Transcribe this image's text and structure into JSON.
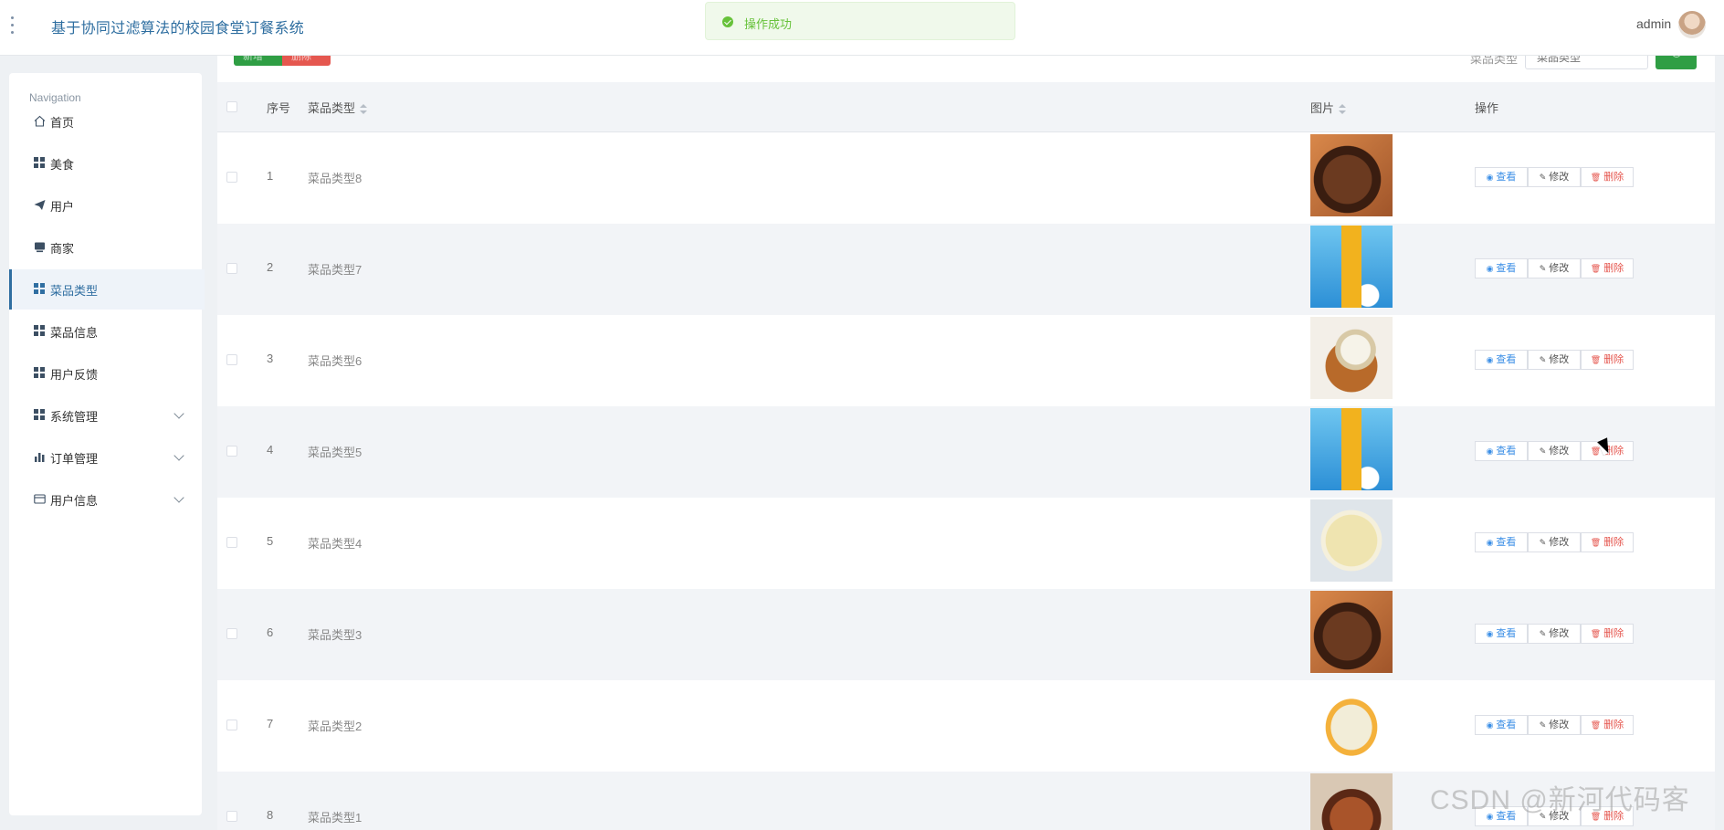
{
  "header": {
    "app_title": "基于协同过滤算法的校园食堂订餐系统",
    "toast": "操作成功",
    "user_name": "admin"
  },
  "sidebar": {
    "heading": "Navigation",
    "items": [
      {
        "label": "首页",
        "icon": "home-icon"
      },
      {
        "label": "美食",
        "icon": "grid-icon"
      },
      {
        "label": "用户",
        "icon": "send-icon"
      },
      {
        "label": "商家",
        "icon": "store-icon"
      },
      {
        "label": "菜品类型",
        "icon": "grid-icon",
        "active": true
      },
      {
        "label": "菜品信息",
        "icon": "grid-icon"
      },
      {
        "label": "用户反馈",
        "icon": "grid-icon"
      },
      {
        "label": "系统管理",
        "icon": "grid-icon",
        "expandable": true
      },
      {
        "label": "订单管理",
        "icon": "bar-chart-icon",
        "expandable": true
      },
      {
        "label": "用户信息",
        "icon": "card-icon",
        "expandable": true
      }
    ]
  },
  "toolbar": {
    "add_label": "新增",
    "delete_label": "删除",
    "search_label": "菜品类型",
    "search_placeholder": "菜品类型"
  },
  "table": {
    "columns": [
      "序号",
      "菜品类型",
      "图片",
      "操作"
    ],
    "rows": [
      {
        "index": "1",
        "name": "菜品类型8",
        "image": "steak"
      },
      {
        "index": "2",
        "name": "菜品类型7",
        "image": "juice"
      },
      {
        "index": "3",
        "name": "菜品类型6",
        "image": "curry"
      },
      {
        "index": "4",
        "name": "菜品类型5",
        "image": "juice"
      },
      {
        "index": "5",
        "name": "菜品类型4",
        "image": "soup"
      },
      {
        "index": "6",
        "name": "菜品类型3",
        "image": "steak"
      },
      {
        "index": "7",
        "name": "菜品类型2",
        "image": "noodles"
      },
      {
        "index": "8",
        "name": "菜品类型1",
        "image": "chicken"
      }
    ],
    "actions": {
      "view": "查看",
      "edit": "修改",
      "delete": "删除"
    }
  },
  "watermark": "CSDN @新河代码客"
}
